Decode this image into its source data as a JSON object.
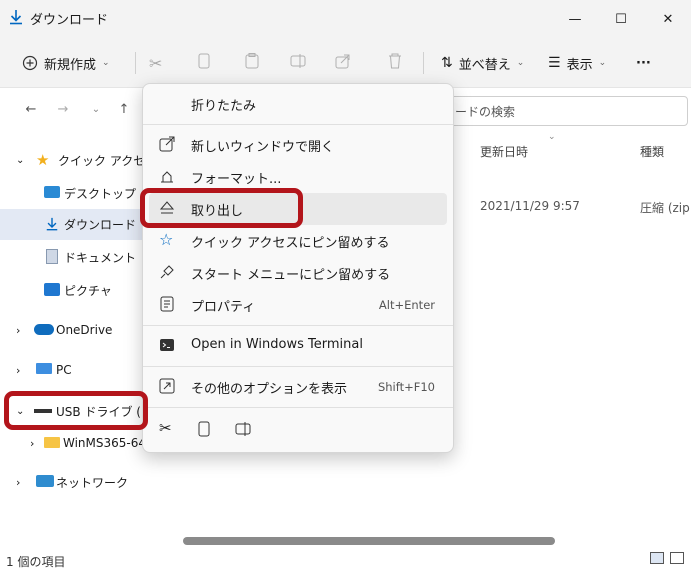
{
  "window": {
    "title": "ダウンロード",
    "minimize": "—",
    "maximize": "☐",
    "close": "✕"
  },
  "toolbar": {
    "new_label": "新規作成",
    "sort_label": "並べ替え",
    "view_label": "表示",
    "more_label": "···"
  },
  "search": {
    "placeholder": "ードの検索"
  },
  "nav": {
    "quick_access": "クイック アクセス",
    "desktop": "デスクトップ",
    "downloads": "ダウンロード",
    "documents": "ドキュメント",
    "pictures": "ピクチャ",
    "onedrive": "OneDrive",
    "pc": "PC",
    "usb": "USB ドライブ (D:)",
    "usb_child": "WinMS365-64l",
    "network": "ネットワーク"
  },
  "content": {
    "col_date": "更新日時",
    "col_type": "種類",
    "row_date": "2021/11/29 9:57",
    "row_type": "圧縮 (zip"
  },
  "menu": {
    "collapse": "折りたたみ",
    "open_new_window": "新しいウィンドウで開く",
    "format": "フォーマット...",
    "eject": "取り出し",
    "pin_quick": "クイック アクセスにピン留めする",
    "pin_start": "スタート メニューにピン留めする",
    "properties": "プロパティ",
    "properties_shortcut": "Alt+Enter",
    "terminal": "Open in Windows Terminal",
    "more_options": "その他のオプションを表示",
    "more_options_shortcut": "Shift+F10"
  },
  "status": {
    "items": "1 個の項目"
  },
  "colors": {
    "accent": "#0067c0",
    "highlight": "#b3151b",
    "folder": "#f6c445"
  }
}
